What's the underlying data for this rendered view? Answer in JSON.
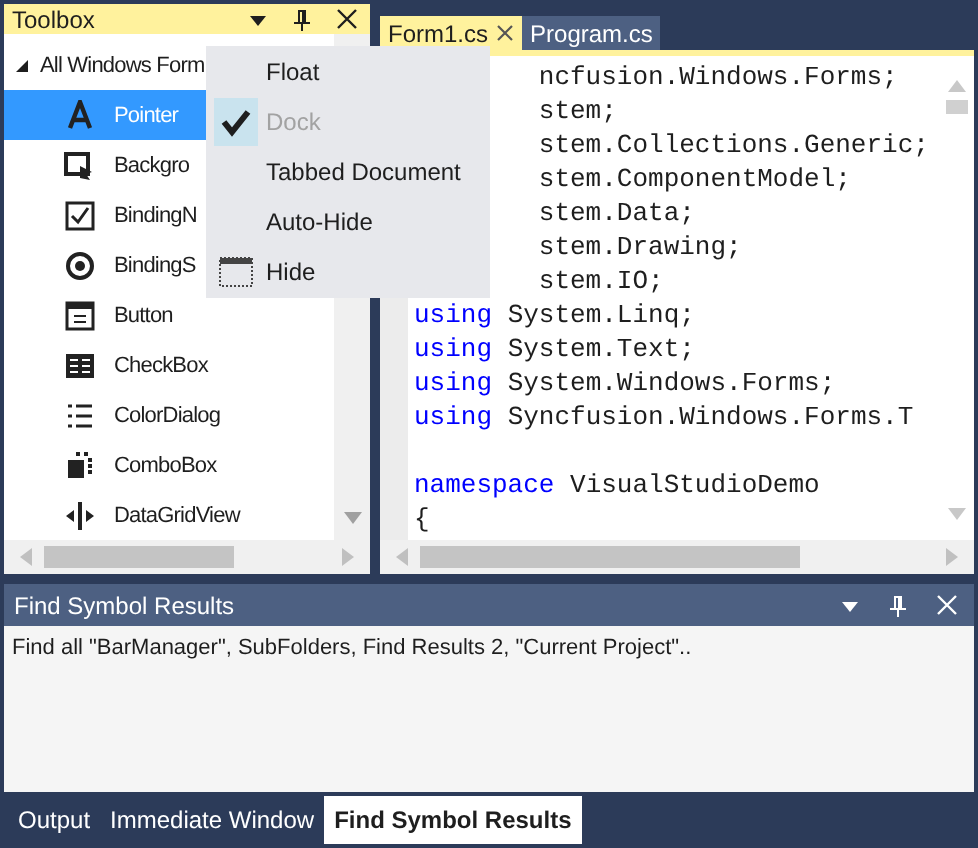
{
  "toolbox": {
    "title": "Toolbox",
    "group": {
      "label": "All Windows Form",
      "expanded": true,
      "items": [
        {
          "label": "Pointer",
          "selected": true
        },
        {
          "label": "Backgro",
          "selected": false
        },
        {
          "label": "BindingN",
          "selected": false
        },
        {
          "label": "BindingS",
          "selected": false
        },
        {
          "label": "Button",
          "selected": false
        },
        {
          "label": "CheckBox",
          "selected": false
        },
        {
          "label": "ColorDialog",
          "selected": false
        },
        {
          "label": "ComboBox",
          "selected": false
        },
        {
          "label": "DataGridView",
          "selected": false
        }
      ]
    }
  },
  "context_menu": [
    {
      "label": "Float",
      "kind": "plain",
      "checked": false,
      "disabled": false
    },
    {
      "label": "Dock",
      "kind": "plain",
      "checked": true,
      "disabled": true
    },
    {
      "label": "Tabbed Document",
      "kind": "plain",
      "checked": false,
      "disabled": false
    },
    {
      "label": "Auto-Hide",
      "kind": "plain",
      "checked": false,
      "disabled": false
    },
    {
      "label": "Hide",
      "kind": "icon",
      "checked": false,
      "disabled": false
    }
  ],
  "editor": {
    "tabs": [
      {
        "label": "Form1.cs",
        "selected": true
      },
      {
        "label": "Program.cs",
        "selected": false
      }
    ],
    "lines": [
      {
        "kind": "partial",
        "text": "ncfusion.Windows.Forms;"
      },
      {
        "kind": "partial",
        "text": "stem;"
      },
      {
        "kind": "partial",
        "text": "stem.Collections.Generic;"
      },
      {
        "kind": "partial",
        "text": "stem.ComponentModel;"
      },
      {
        "kind": "partial",
        "text": "stem.Data;"
      },
      {
        "kind": "partial",
        "text": "stem.Drawing;"
      },
      {
        "kind": "partial",
        "text": "stem.IO;"
      },
      {
        "kind": "code",
        "keyword": "using",
        "text": "System.Linq;"
      },
      {
        "kind": "code",
        "keyword": "using",
        "text": "System.Text;"
      },
      {
        "kind": "code",
        "keyword": "using",
        "text": "System.Windows.Forms;"
      },
      {
        "kind": "code",
        "keyword": "using",
        "text": "Syncfusion.Windows.Forms.T"
      },
      {
        "kind": "blank"
      },
      {
        "kind": "code",
        "keyword": "namespace",
        "text": "VisualStudioDemo"
      },
      {
        "kind": "code",
        "text": "{"
      }
    ]
  },
  "results_panel": {
    "title": "Find Symbol Results",
    "text": "Find all \"BarManager\", SubFolders, Find Results 2, \"Current Project\".."
  },
  "bottom_tabs": [
    {
      "label": "Output",
      "selected": false
    },
    {
      "label": "Immediate Window",
      "selected": false
    },
    {
      "label": "Find Symbol Results",
      "selected": true
    }
  ]
}
